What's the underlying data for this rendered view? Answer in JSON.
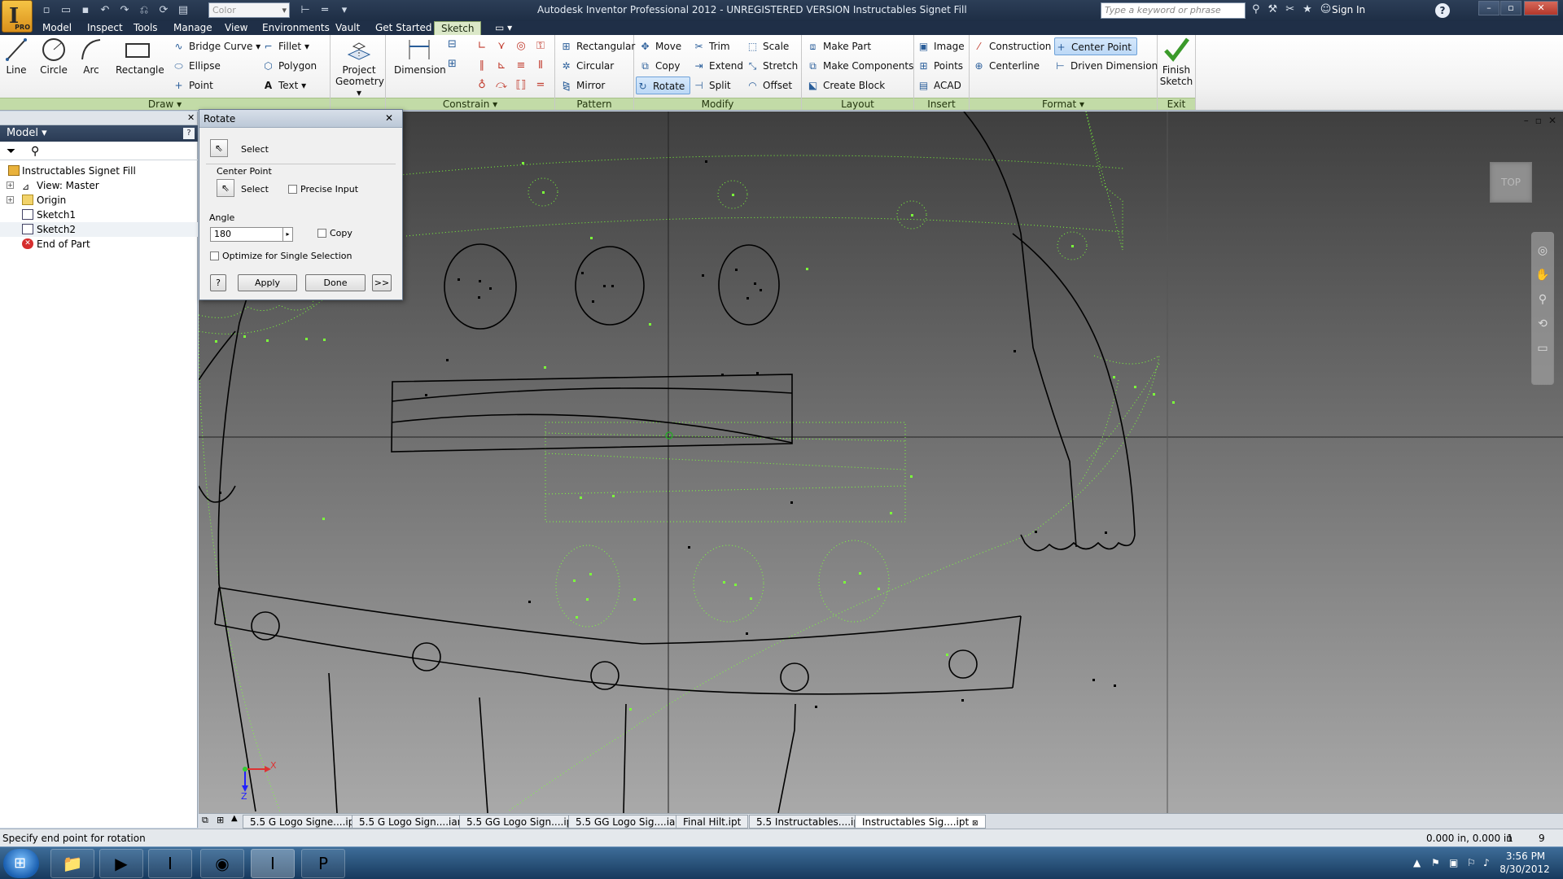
{
  "window": {
    "title": "Autodesk Inventor Professional 2012 - UNREGISTERED VERSION    Instructables Signet Fill",
    "app_badge": "PRO",
    "color_combo": "Color",
    "search_placeholder": "Type a keyword or phrase",
    "sign_in": "Sign In",
    "help": "?"
  },
  "ribbon_tabs": [
    "Model",
    "Inspect",
    "Tools",
    "Manage",
    "View",
    "Environments",
    "Vault",
    "Get Started",
    "Sketch"
  ],
  "active_tab": "Sketch",
  "panels": {
    "draw": {
      "title": "Draw ▾",
      "line": "Line",
      "circle": "Circle",
      "arc": "Arc",
      "rectangle": "Rectangle",
      "bridge_curve": "Bridge Curve",
      "ellipse": "Ellipse",
      "point": "Point",
      "fillet": "Fillet",
      "polygon": "Polygon",
      "text": "Text"
    },
    "project_geometry": {
      "line1": "Project",
      "line2": "Geometry"
    },
    "constrain": {
      "title": "Constrain ▾",
      "dimension": "Dimension"
    },
    "pattern": {
      "title": "Pattern",
      "rectangular": "Rectangular",
      "circular": "Circular",
      "mirror": "Mirror"
    },
    "modify": {
      "title": "Modify",
      "move": "Move",
      "copy": "Copy",
      "rotate": "Rotate",
      "trim": "Trim",
      "extend": "Extend",
      "split": "Split",
      "scale": "Scale",
      "stretch": "Stretch",
      "offset": "Offset"
    },
    "layout": {
      "title": "Layout",
      "make_part": "Make Part",
      "make_components": "Make Components",
      "create_block": "Create Block"
    },
    "insert": {
      "title": "Insert",
      "image": "Image",
      "points": "Points",
      "acad": "ACAD"
    },
    "format": {
      "title": "Format ▾",
      "construction": "Construction",
      "centerline": "Centerline",
      "center_point": "Center Point",
      "driven_dimension": "Driven Dimension"
    },
    "exit": {
      "title": "Exit",
      "finish1": "Finish",
      "finish2": "Sketch"
    }
  },
  "browser": {
    "header": "Model ▾",
    "help": "?",
    "tree": [
      {
        "label": "Instructables Signet Fill",
        "indent": 0,
        "icon": "part-icon"
      },
      {
        "label": "View: Master",
        "indent": 1,
        "icon": "view-icon",
        "expander": "+"
      },
      {
        "label": "Origin",
        "indent": 1,
        "icon": "folder-icon",
        "expander": "+"
      },
      {
        "label": "Sketch1",
        "indent": 1,
        "icon": "sketch-icon"
      },
      {
        "label": "Sketch2",
        "indent": 1,
        "icon": "sketch-icon"
      },
      {
        "label": "End of Part",
        "indent": 1,
        "icon": "end-of-part-icon"
      }
    ]
  },
  "rotate_dialog": {
    "title": "Rotate",
    "select_label": "Select",
    "center_point_label": "Center Point",
    "center_select_label": "Select",
    "precise_input_label": "Precise Input",
    "angle_label": "Angle",
    "angle_value": "180",
    "copy_label": "Copy",
    "optimize_label": "Optimize for Single Selection",
    "help": "?",
    "apply": "Apply",
    "done": "Done",
    "more": ">>"
  },
  "viewcube_label": "TOP",
  "axis": {
    "x": "X",
    "z": "Z"
  },
  "doc_tabs": [
    "5.5 G Logo Signe....ipt",
    "5.5 G Logo Sign....iam",
    "5.5 GG Logo Sign....ipt",
    "5.5 GG Logo Sig....iam",
    "Final Hilt.ipt",
    "5.5 Instructables....ipt",
    "Instructables Sig....ipt"
  ],
  "active_doc_tab": 6,
  "status": {
    "prompt": "Specify end point for rotation",
    "coords": "0.000 in, 0.000 in",
    "n1": "1",
    "n2": "9"
  },
  "taskbar": {
    "items": [
      "windows-explorer-icon",
      "media-player-icon",
      "inventor-pro-icon",
      "chrome-icon",
      "inventor-active-icon",
      "powerpoint-icon"
    ],
    "time": "3:56 PM",
    "date": "8/30/2012"
  },
  "colors": {
    "ribbon_panel_title": "#c2dba7",
    "construction_green": "#7cff3a",
    "title_bar": "#1e2e45",
    "accent_blue": "#6fa2d8"
  }
}
